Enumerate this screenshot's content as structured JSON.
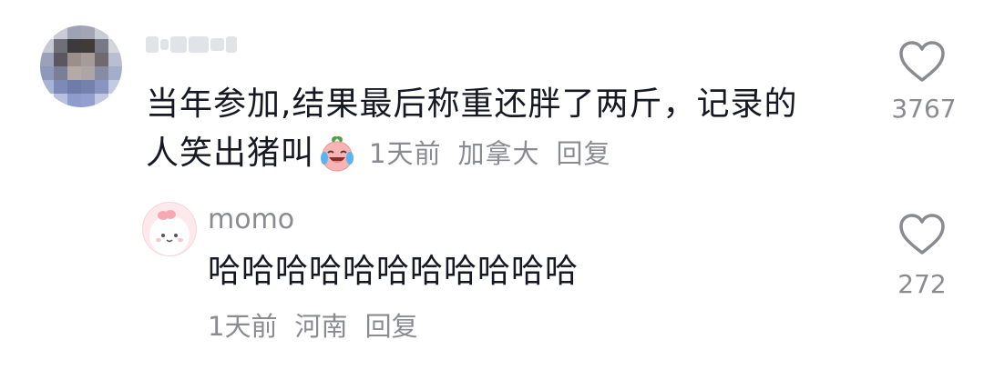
{
  "comments": [
    {
      "username": "",
      "text_line1": "当年参加,结果最后称重还胖了两斤，记录的",
      "text_line2": "人笑出猪叫",
      "emoji": "crying-laughing-peach-emoji",
      "time": "1天前",
      "location": "加拿大",
      "reply_label": "回复",
      "like_count": "3767"
    }
  ],
  "replies": [
    {
      "username": "momo",
      "text": "哈哈哈哈哈哈哈哈哈哈哈",
      "time": "1天前",
      "location": "河南",
      "reply_label": "回复",
      "like_count": "272"
    }
  ],
  "colors": {
    "text": "#161823",
    "meta": "#8a8b91",
    "heart_outline": "#8a8b91"
  }
}
